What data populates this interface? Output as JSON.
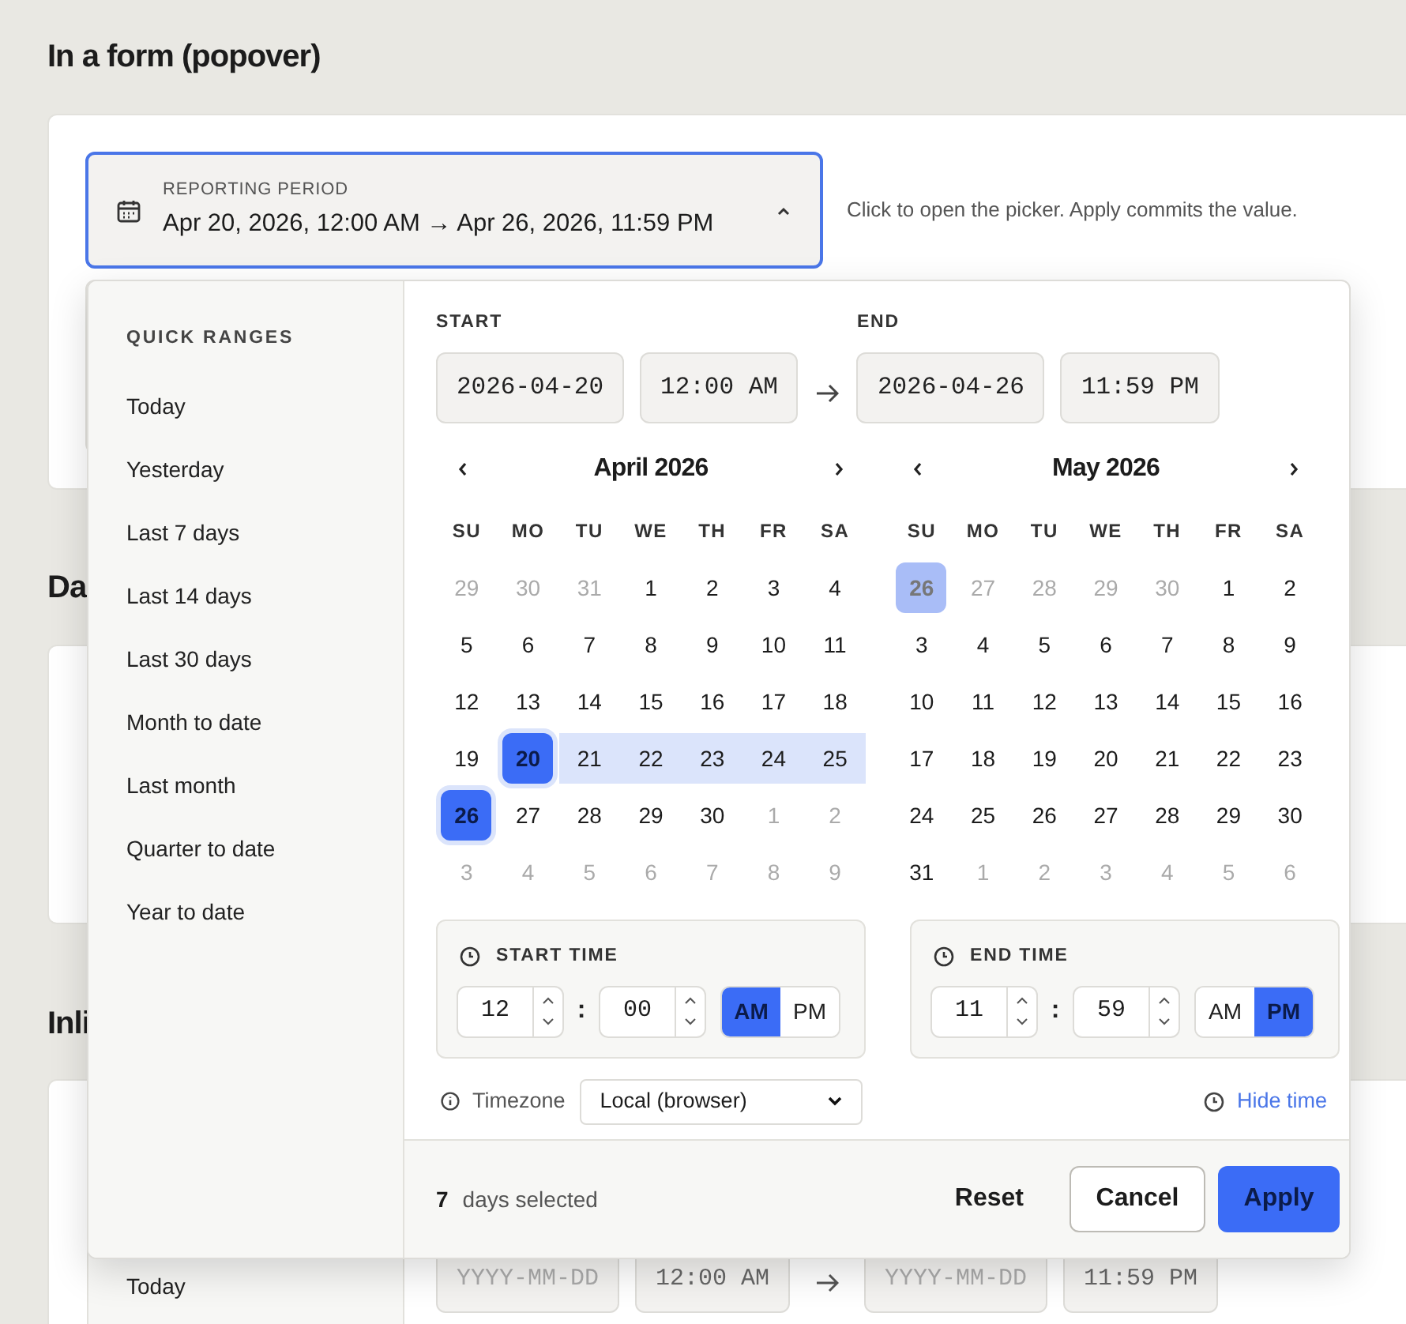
{
  "headings": [
    "In a form (popover)",
    "Da",
    "Inli"
  ],
  "trigger": {
    "label": "REPORTING PERIOD",
    "value": "Apr 20, 2026, 12:00 AM → Apr 26, 2026, 11:59 PM",
    "expanded": true,
    "hint": "Click to open the picker. Apply commits the value."
  },
  "popover": {
    "quick_ranges_title": "QUICK RANGES",
    "quick_ranges": [
      "Today",
      "Yesterday",
      "Last 7 days",
      "Last 14 days",
      "Last 30 days",
      "Month to date",
      "Last month",
      "Quarter to date",
      "Year to date"
    ],
    "start": {
      "label": "START",
      "date": "2026-04-20",
      "time": "12:00 AM"
    },
    "end": {
      "label": "END",
      "date": "2026-04-26",
      "time": "11:59 PM"
    },
    "calendars": [
      {
        "title": "April 2026",
        "weekdays": [
          "SU",
          "MO",
          "TU",
          "WE",
          "TH",
          "FR",
          "SA"
        ],
        "days": [
          {
            "label": "29",
            "outside": true,
            "selected": false,
            "in_range": false
          },
          {
            "label": "30",
            "outside": true,
            "selected": false,
            "in_range": false
          },
          {
            "label": "31",
            "outside": true,
            "selected": false,
            "in_range": false
          },
          {
            "label": "1",
            "outside": false,
            "selected": false,
            "in_range": false
          },
          {
            "label": "2",
            "outside": false,
            "selected": false,
            "in_range": false
          },
          {
            "label": "3",
            "outside": false,
            "selected": false,
            "in_range": false
          },
          {
            "label": "4",
            "outside": false,
            "selected": false,
            "in_range": false
          },
          {
            "label": "5",
            "outside": false,
            "selected": false,
            "in_range": false
          },
          {
            "label": "6",
            "outside": false,
            "selected": false,
            "in_range": false
          },
          {
            "label": "7",
            "outside": false,
            "selected": false,
            "in_range": false
          },
          {
            "label": "8",
            "outside": false,
            "selected": false,
            "in_range": false
          },
          {
            "label": "9",
            "outside": false,
            "selected": false,
            "in_range": false
          },
          {
            "label": "10",
            "outside": false,
            "selected": false,
            "in_range": false
          },
          {
            "label": "11",
            "outside": false,
            "selected": false,
            "in_range": false
          },
          {
            "label": "12",
            "outside": false,
            "selected": false,
            "in_range": false
          },
          {
            "label": "13",
            "outside": false,
            "selected": false,
            "in_range": false
          },
          {
            "label": "14",
            "outside": false,
            "selected": false,
            "in_range": false
          },
          {
            "label": "15",
            "outside": false,
            "selected": false,
            "in_range": false
          },
          {
            "label": "16",
            "outside": false,
            "selected": false,
            "in_range": false
          },
          {
            "label": "17",
            "outside": false,
            "selected": false,
            "in_range": false
          },
          {
            "label": "18",
            "outside": false,
            "selected": false,
            "in_range": false
          },
          {
            "label": "19",
            "outside": false,
            "selected": false,
            "in_range": false
          },
          {
            "label": "20",
            "outside": false,
            "selected": true,
            "in_range": true
          },
          {
            "label": "21",
            "outside": false,
            "selected": false,
            "in_range": true
          },
          {
            "label": "22",
            "outside": false,
            "selected": false,
            "in_range": true
          },
          {
            "label": "23",
            "outside": false,
            "selected": false,
            "in_range": true
          },
          {
            "label": "24",
            "outside": false,
            "selected": false,
            "in_range": true
          },
          {
            "label": "25",
            "outside": false,
            "selected": false,
            "in_range": true
          },
          {
            "label": "26",
            "outside": false,
            "selected": true,
            "in_range": true
          },
          {
            "label": "27",
            "outside": false,
            "selected": false,
            "in_range": false
          },
          {
            "label": "28",
            "outside": false,
            "selected": false,
            "in_range": false
          },
          {
            "label": "29",
            "outside": false,
            "selected": false,
            "in_range": false
          },
          {
            "label": "30",
            "outside": false,
            "selected": false,
            "in_range": false
          },
          {
            "label": "1",
            "outside": true,
            "selected": false,
            "in_range": false
          },
          {
            "label": "2",
            "outside": true,
            "selected": false,
            "in_range": false
          },
          {
            "label": "3",
            "outside": true,
            "selected": false,
            "in_range": false
          },
          {
            "label": "4",
            "outside": true,
            "selected": false,
            "in_range": false
          },
          {
            "label": "5",
            "outside": true,
            "selected": false,
            "in_range": false
          },
          {
            "label": "6",
            "outside": true,
            "selected": false,
            "in_range": false
          },
          {
            "label": "7",
            "outside": true,
            "selected": false,
            "in_range": false
          },
          {
            "label": "8",
            "outside": true,
            "selected": false,
            "in_range": false
          },
          {
            "label": "9",
            "outside": true,
            "selected": false,
            "in_range": false
          }
        ]
      },
      {
        "title": "May 2026",
        "weekdays": [
          "SU",
          "MO",
          "TU",
          "WE",
          "TH",
          "FR",
          "SA"
        ],
        "days": [
          {
            "label": "26",
            "outside": true,
            "selected": true,
            "in_range": false
          },
          {
            "label": "27",
            "outside": true,
            "selected": false,
            "in_range": false
          },
          {
            "label": "28",
            "outside": true,
            "selected": false,
            "in_range": false
          },
          {
            "label": "29",
            "outside": true,
            "selected": false,
            "in_range": false
          },
          {
            "label": "30",
            "outside": true,
            "selected": false,
            "in_range": false
          },
          {
            "label": "1",
            "outside": false,
            "selected": false,
            "in_range": false
          },
          {
            "label": "2",
            "outside": false,
            "selected": false,
            "in_range": false
          },
          {
            "label": "3",
            "outside": false,
            "selected": false,
            "in_range": false
          },
          {
            "label": "4",
            "outside": false,
            "selected": false,
            "in_range": false
          },
          {
            "label": "5",
            "outside": false,
            "selected": false,
            "in_range": false
          },
          {
            "label": "6",
            "outside": false,
            "selected": false,
            "in_range": false
          },
          {
            "label": "7",
            "outside": false,
            "selected": false,
            "in_range": false
          },
          {
            "label": "8",
            "outside": false,
            "selected": false,
            "in_range": false
          },
          {
            "label": "9",
            "outside": false,
            "selected": false,
            "in_range": false
          },
          {
            "label": "10",
            "outside": false,
            "selected": false,
            "in_range": false
          },
          {
            "label": "11",
            "outside": false,
            "selected": false,
            "in_range": false
          },
          {
            "label": "12",
            "outside": false,
            "selected": false,
            "in_range": false
          },
          {
            "label": "13",
            "outside": false,
            "selected": false,
            "in_range": false
          },
          {
            "label": "14",
            "outside": false,
            "selected": false,
            "in_range": false
          },
          {
            "label": "15",
            "outside": false,
            "selected": false,
            "in_range": false
          },
          {
            "label": "16",
            "outside": false,
            "selected": false,
            "in_range": false
          },
          {
            "label": "17",
            "outside": false,
            "selected": false,
            "in_range": false
          },
          {
            "label": "18",
            "outside": false,
            "selected": false,
            "in_range": false
          },
          {
            "label": "19",
            "outside": false,
            "selected": false,
            "in_range": false
          },
          {
            "label": "20",
            "outside": false,
            "selected": false,
            "in_range": false
          },
          {
            "label": "21",
            "outside": false,
            "selected": false,
            "in_range": false
          },
          {
            "label": "22",
            "outside": false,
            "selected": false,
            "in_range": false
          },
          {
            "label": "23",
            "outside": false,
            "selected": false,
            "in_range": false
          },
          {
            "label": "24",
            "outside": false,
            "selected": false,
            "in_range": false
          },
          {
            "label": "25",
            "outside": false,
            "selected": false,
            "in_range": false
          },
          {
            "label": "26",
            "outside": false,
            "selected": false,
            "in_range": false
          },
          {
            "label": "27",
            "outside": false,
            "selected": false,
            "in_range": false
          },
          {
            "label": "28",
            "outside": false,
            "selected": false,
            "in_range": false
          },
          {
            "label": "29",
            "outside": false,
            "selected": false,
            "in_range": false
          },
          {
            "label": "30",
            "outside": false,
            "selected": false,
            "in_range": false
          },
          {
            "label": "31",
            "outside": false,
            "selected": false,
            "in_range": false
          },
          {
            "label": "1",
            "outside": true,
            "selected": false,
            "in_range": false
          },
          {
            "label": "2",
            "outside": true,
            "selected": false,
            "in_range": false
          },
          {
            "label": "3",
            "outside": true,
            "selected": false,
            "in_range": false
          },
          {
            "label": "4",
            "outside": true,
            "selected": false,
            "in_range": false
          },
          {
            "label": "5",
            "outside": true,
            "selected": false,
            "in_range": false
          },
          {
            "label": "6",
            "outside": true,
            "selected": false,
            "in_range": false
          }
        ]
      }
    ],
    "times": [
      {
        "label": "START TIME",
        "hour": "12",
        "separator": ":",
        "minute": "00",
        "periods": [
          {
            "label": "AM",
            "selected": true
          },
          {
            "label": "PM",
            "selected": false
          }
        ]
      },
      {
        "label": "END TIME",
        "hour": "11",
        "separator": ":",
        "minute": "59",
        "periods": [
          {
            "label": "AM",
            "selected": false
          },
          {
            "label": "PM",
            "selected": true
          }
        ]
      }
    ],
    "timezone": {
      "label": "Timezone",
      "value": "Local (browser)"
    },
    "hide_time": "Hide time",
    "summary": {
      "count": "7",
      "text": "days selected"
    },
    "buttons": [
      {
        "label": "Reset",
        "kind": "text"
      },
      {
        "label": "Cancel",
        "kind": "outline"
      },
      {
        "label": "Apply",
        "kind": "primary"
      }
    ]
  },
  "inline_picker": {
    "quick_ranges": [
      "Today"
    ],
    "start": {
      "placeholder": "YYYY-MM-DD",
      "time": "12:00 AM"
    },
    "end": {
      "placeholder": "YYYY-MM-DD",
      "time": "11:59 PM"
    }
  }
}
